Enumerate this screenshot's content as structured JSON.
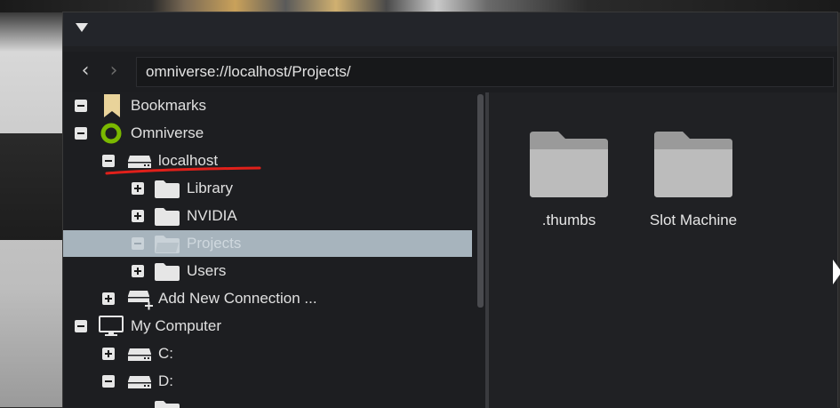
{
  "toolbar": {
    "back_icon": "chevron-left-icon",
    "forward_icon": "chevron-right-icon",
    "address": "omniverse://localhost/Projects/"
  },
  "tree": {
    "bookmarks": "Bookmarks",
    "omniverse": "Omniverse",
    "localhost": "localhost",
    "library": "Library",
    "nvidia": "NVIDIA",
    "projects": "Projects",
    "users": "Users",
    "add_connection": "Add New Connection ...",
    "my_computer": "My Computer",
    "drive_c": "C:",
    "drive_d": "D:"
  },
  "content": {
    "folders": [
      ".thumbs",
      "Slot Machine"
    ]
  },
  "colors": {
    "selected_row": "#a7b4bd",
    "annotation_red": "#e0201a",
    "bookmark_yellow": "#e9d39a",
    "omniverse_green": "#7ab800"
  }
}
